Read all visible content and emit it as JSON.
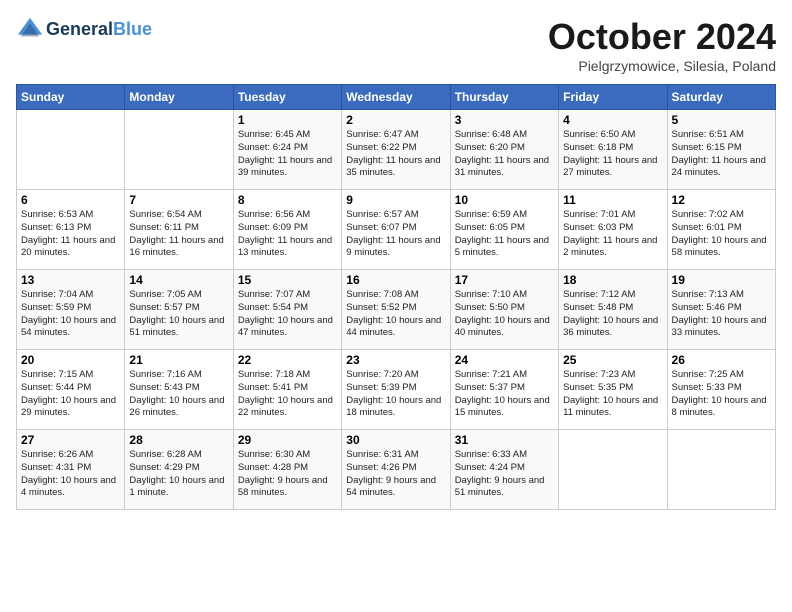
{
  "header": {
    "logo_line1": "General",
    "logo_line2": "Blue",
    "month": "October 2024",
    "location": "Pielgrzymowice, Silesia, Poland"
  },
  "weekdays": [
    "Sunday",
    "Monday",
    "Tuesday",
    "Wednesday",
    "Thursday",
    "Friday",
    "Saturday"
  ],
  "weeks": [
    [
      {
        "day": "",
        "content": ""
      },
      {
        "day": "",
        "content": ""
      },
      {
        "day": "1",
        "content": "Sunrise: 6:45 AM\nSunset: 6:24 PM\nDaylight: 11 hours and 39 minutes."
      },
      {
        "day": "2",
        "content": "Sunrise: 6:47 AM\nSunset: 6:22 PM\nDaylight: 11 hours and 35 minutes."
      },
      {
        "day": "3",
        "content": "Sunrise: 6:48 AM\nSunset: 6:20 PM\nDaylight: 11 hours and 31 minutes."
      },
      {
        "day": "4",
        "content": "Sunrise: 6:50 AM\nSunset: 6:18 PM\nDaylight: 11 hours and 27 minutes."
      },
      {
        "day": "5",
        "content": "Sunrise: 6:51 AM\nSunset: 6:15 PM\nDaylight: 11 hours and 24 minutes."
      }
    ],
    [
      {
        "day": "6",
        "content": "Sunrise: 6:53 AM\nSunset: 6:13 PM\nDaylight: 11 hours and 20 minutes."
      },
      {
        "day": "7",
        "content": "Sunrise: 6:54 AM\nSunset: 6:11 PM\nDaylight: 11 hours and 16 minutes."
      },
      {
        "day": "8",
        "content": "Sunrise: 6:56 AM\nSunset: 6:09 PM\nDaylight: 11 hours and 13 minutes."
      },
      {
        "day": "9",
        "content": "Sunrise: 6:57 AM\nSunset: 6:07 PM\nDaylight: 11 hours and 9 minutes."
      },
      {
        "day": "10",
        "content": "Sunrise: 6:59 AM\nSunset: 6:05 PM\nDaylight: 11 hours and 5 minutes."
      },
      {
        "day": "11",
        "content": "Sunrise: 7:01 AM\nSunset: 6:03 PM\nDaylight: 11 hours and 2 minutes."
      },
      {
        "day": "12",
        "content": "Sunrise: 7:02 AM\nSunset: 6:01 PM\nDaylight: 10 hours and 58 minutes."
      }
    ],
    [
      {
        "day": "13",
        "content": "Sunrise: 7:04 AM\nSunset: 5:59 PM\nDaylight: 10 hours and 54 minutes."
      },
      {
        "day": "14",
        "content": "Sunrise: 7:05 AM\nSunset: 5:57 PM\nDaylight: 10 hours and 51 minutes."
      },
      {
        "day": "15",
        "content": "Sunrise: 7:07 AM\nSunset: 5:54 PM\nDaylight: 10 hours and 47 minutes."
      },
      {
        "day": "16",
        "content": "Sunrise: 7:08 AM\nSunset: 5:52 PM\nDaylight: 10 hours and 44 minutes."
      },
      {
        "day": "17",
        "content": "Sunrise: 7:10 AM\nSunset: 5:50 PM\nDaylight: 10 hours and 40 minutes."
      },
      {
        "day": "18",
        "content": "Sunrise: 7:12 AM\nSunset: 5:48 PM\nDaylight: 10 hours and 36 minutes."
      },
      {
        "day": "19",
        "content": "Sunrise: 7:13 AM\nSunset: 5:46 PM\nDaylight: 10 hours and 33 minutes."
      }
    ],
    [
      {
        "day": "20",
        "content": "Sunrise: 7:15 AM\nSunset: 5:44 PM\nDaylight: 10 hours and 29 minutes."
      },
      {
        "day": "21",
        "content": "Sunrise: 7:16 AM\nSunset: 5:43 PM\nDaylight: 10 hours and 26 minutes."
      },
      {
        "day": "22",
        "content": "Sunrise: 7:18 AM\nSunset: 5:41 PM\nDaylight: 10 hours and 22 minutes."
      },
      {
        "day": "23",
        "content": "Sunrise: 7:20 AM\nSunset: 5:39 PM\nDaylight: 10 hours and 18 minutes."
      },
      {
        "day": "24",
        "content": "Sunrise: 7:21 AM\nSunset: 5:37 PM\nDaylight: 10 hours and 15 minutes."
      },
      {
        "day": "25",
        "content": "Sunrise: 7:23 AM\nSunset: 5:35 PM\nDaylight: 10 hours and 11 minutes."
      },
      {
        "day": "26",
        "content": "Sunrise: 7:25 AM\nSunset: 5:33 PM\nDaylight: 10 hours and 8 minutes."
      }
    ],
    [
      {
        "day": "27",
        "content": "Sunrise: 6:26 AM\nSunset: 4:31 PM\nDaylight: 10 hours and 4 minutes."
      },
      {
        "day": "28",
        "content": "Sunrise: 6:28 AM\nSunset: 4:29 PM\nDaylight: 10 hours and 1 minute."
      },
      {
        "day": "29",
        "content": "Sunrise: 6:30 AM\nSunset: 4:28 PM\nDaylight: 9 hours and 58 minutes."
      },
      {
        "day": "30",
        "content": "Sunrise: 6:31 AM\nSunset: 4:26 PM\nDaylight: 9 hours and 54 minutes."
      },
      {
        "day": "31",
        "content": "Sunrise: 6:33 AM\nSunset: 4:24 PM\nDaylight: 9 hours and 51 minutes."
      },
      {
        "day": "",
        "content": ""
      },
      {
        "day": "",
        "content": ""
      }
    ]
  ]
}
